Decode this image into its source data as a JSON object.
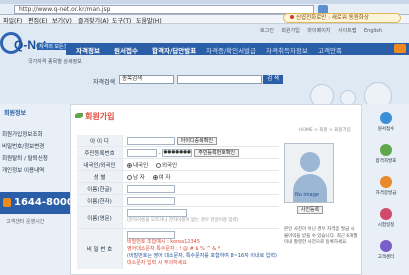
{
  "browser": {
    "url": "http://www.q-net.or.kr/man.jsp",
    "menus": [
      "파일(F)",
      "편집(E)",
      "보기(V)",
      "즐겨찾기(A)",
      "도구(T)",
      "도움말(H)"
    ],
    "sync_status": "신엽전화로만 : 새로워 동원화상"
  },
  "site": {
    "logo": "Q-Net",
    "logo_badge": "자격의 모든것",
    "util_links": [
      "로그인",
      "회원가입",
      "마이페이지",
      "사이트맵",
      "English"
    ],
    "nav": [
      "자격정보",
      "원서접수",
      "합격자/답안발표",
      "자격증/확인서발급",
      "자격취득자정보",
      "고객만족"
    ],
    "greeting": "국가자격 종목별 상세정보",
    "search": {
      "label": "자격검색",
      "select": "종목검색",
      "button": "검 색"
    }
  },
  "left": {
    "title": "회원정보",
    "links": [
      "회원가입정보조회",
      "비밀번호/정보변경",
      "회원탈퇴 / 탈퇴신청",
      "개인정보 이용내역"
    ],
    "phone": "1644-8000",
    "footnote": "고객센터 운영시간"
  },
  "content": {
    "heading": "회원가입",
    "breadcrumb": "HOME > 회원 > 회원가입",
    "form": {
      "id_label": "아 이 디",
      "id_button": "아이디중복확인",
      "ssn_label": "주민등록번호",
      "ssn_mask": "●●●●●●●",
      "ssn_button": "주민등록번호확인",
      "nationality_label": "내국인/외국인",
      "nationality_options": [
        "내국인",
        "외국인"
      ],
      "gender_label": "성 별",
      "gender_options": [
        "남 자",
        "여 자"
      ],
      "name_kr_label": "이름(한글)",
      "name_hanja_label": "이름(한자)",
      "name_en_label": "이름(영문)",
      "name_en_hint": "(한자이름을 모르거나 한자이름이 없는 경우 한글이름 입력)",
      "password_label": "비 밀 번 호",
      "password_notes": [
        "비밀번호 조합예시 : korea12345",
        "영어대소문자 특수문자 : ! @ # $ % ^ & *",
        "(비밀번호는 영어 대소문자, 특수문자를 포함하여 8~16자 이내로 입력)",
        "대소문자 입력 시 주의하세요"
      ]
    },
    "photo": {
      "caption": "No image",
      "button": "사진등록",
      "note": "본인 사진이 아닌 경우 자격증 발급 시 불이익을 받을 수 있습니다. 최근 6개월 이내 촬영한 사진으로 등록하세요."
    }
  },
  "right": {
    "quick": [
      {
        "label": "원서접수",
        "icon": "clipboard-icon",
        "color": "#3a8fd6"
      },
      {
        "label": "합격자발표",
        "icon": "trophy-icon",
        "color": "#5ea84b"
      },
      {
        "label": "자격증발급",
        "icon": "card-icon",
        "color": "#e88a2a"
      },
      {
        "label": "시험일정",
        "icon": "calendar-icon",
        "color": "#d14a6a"
      },
      {
        "label": "고객센터",
        "icon": "headset-icon",
        "color": "#7a5ec9"
      }
    ]
  }
}
